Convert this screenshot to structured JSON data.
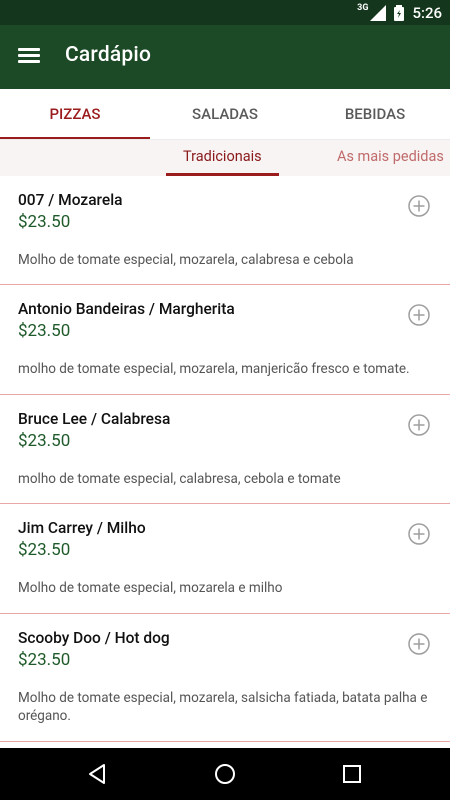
{
  "status_bar": {
    "network": "3G",
    "time": "5:26"
  },
  "toolbar": {
    "title": "Cardápio",
    "menu_icon": "hamburger-menu-icon"
  },
  "tabs": [
    {
      "label": "PIZZAS",
      "active": true
    },
    {
      "label": "SALADAS",
      "active": false
    },
    {
      "label": "BEBIDAS",
      "active": false
    }
  ],
  "subtabs": [
    {
      "label": "Tradicionais",
      "active": true
    },
    {
      "label": "As mais pedidas",
      "active": false
    }
  ],
  "items": [
    {
      "name": "007 / Mozarela",
      "price": "$23.50",
      "desc": "Molho de tomate especial, mozarela, calabresa e cebola"
    },
    {
      "name": "Antonio Bandeiras / Margherita",
      "price": "$23.50",
      "desc": "molho de tomate especial, mozarela, manjericão fresco e tomate."
    },
    {
      "name": "Bruce Lee / Calabresa",
      "price": "$23.50",
      "desc": "molho de tomate especial, calabresa, cebola e tomate"
    },
    {
      "name": "Jim Carrey / Milho",
      "price": "$23.50",
      "desc": "Molho de tomate especial, mozarela e milho"
    },
    {
      "name": "Scooby Doo / Hot dog",
      "price": "$23.50",
      "desc": "Molho de tomate especial, mozarela, salsicha fatiada, batata palha e orégano."
    }
  ],
  "colors": {
    "toolbar": "#1c4a26",
    "status_bar": "#14361c",
    "accent": "#9b1c1c",
    "price": "#1e5a2a",
    "divider": "#e9a7a7"
  },
  "icons": {
    "add": "add-circle-icon",
    "back": "back-triangle-icon",
    "home": "home-circle-icon",
    "recents": "recents-square-icon"
  }
}
